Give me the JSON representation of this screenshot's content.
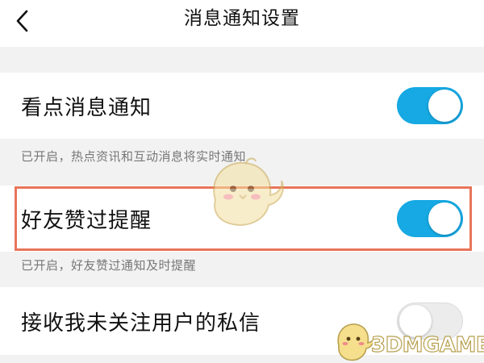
{
  "header": {
    "title": "消息通知设置",
    "back_icon": "chevron-left-icon"
  },
  "settings": [
    {
      "label": "看点消息通知",
      "enabled": true,
      "description": "已开启，热点资讯和互动消息将实时通知"
    },
    {
      "label": "好友赞过提醒",
      "enabled": true,
      "description": "已开启，好友赞过通知及时提醒",
      "highlighted": true
    },
    {
      "label": "接收我未关注用户的私信",
      "enabled": false
    }
  ],
  "watermark": {
    "text": "3DMGAME"
  },
  "colors": {
    "toggle_on": "#16a9e3",
    "toggle_off": "#ececec",
    "highlight_border": "#e8745a",
    "description_text": "#777777"
  }
}
